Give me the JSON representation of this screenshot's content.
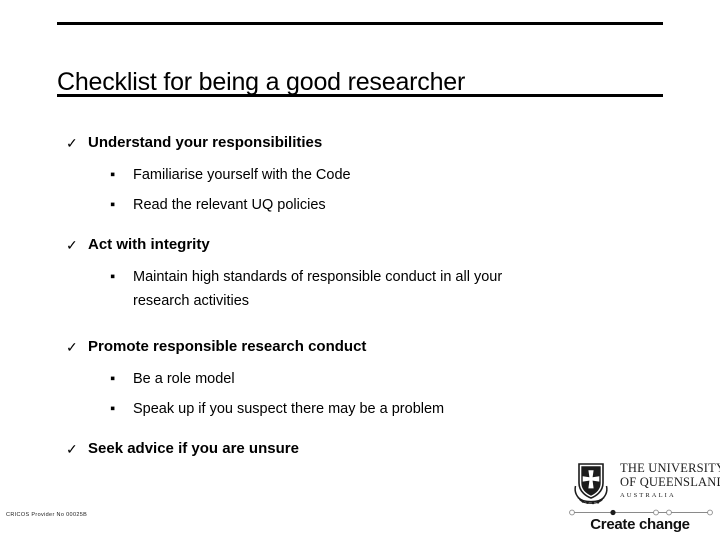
{
  "slide": {
    "title": "Checklist for being a good researcher",
    "background_color": "#ffffff",
    "text_color": "#000000"
  },
  "checklist": {
    "tick_glyph": "✓",
    "square_glyph": "▪",
    "groups": [
      {
        "heading": "Understand your responsibilities",
        "items": [
          {
            "text": "Familiarise yourself with the Code",
            "wrap": ""
          },
          {
            "text": "Read the relevant UQ policies",
            "wrap": ""
          }
        ]
      },
      {
        "heading": "Act with integrity",
        "items": [
          {
            "text": "Maintain high standards of responsible conduct in all your",
            "wrap": "research activities"
          }
        ]
      },
      {
        "heading": "Promote responsible research conduct",
        "items": [
          {
            "text": "Be a role model",
            "wrap": ""
          },
          {
            "text": "Speak up if you suspect there may be a problem",
            "wrap": ""
          }
        ]
      },
      {
        "heading": "Seek advice if you are unsure",
        "items": []
      }
    ]
  },
  "footer": {
    "cricos": "CRICOS Provider No 00025B"
  },
  "logo": {
    "crest_alt": "uq-crest",
    "wordmark_line1": "THE UNIVERSITY",
    "wordmark_line2": "OF QUEENSLAND",
    "wordmark_line3": "AUSTRALIA",
    "tagline": "Create change"
  }
}
